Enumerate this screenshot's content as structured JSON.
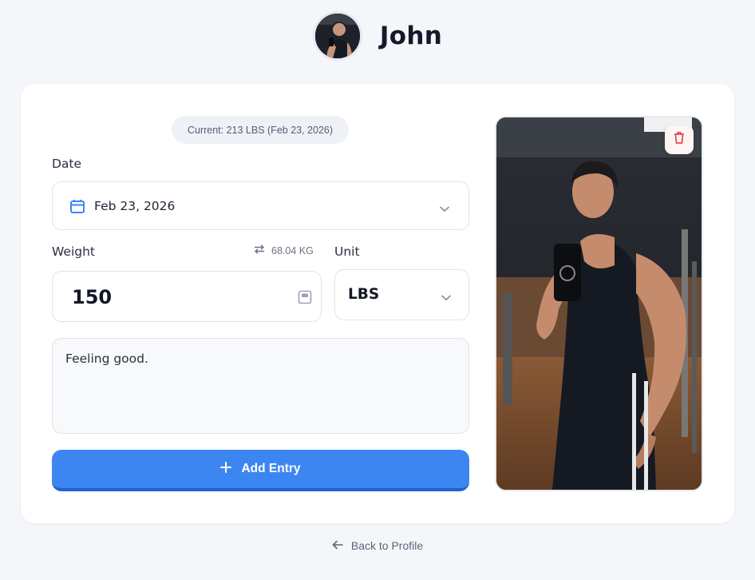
{
  "user": {
    "name": "John"
  },
  "current": {
    "text": "Current: 213 LBS (Feb 23, 2026)"
  },
  "form": {
    "date_label": "Date",
    "date_value": "Feb 23, 2026",
    "weight_label": "Weight",
    "conversion": "68.04 KG",
    "weight_value": "150",
    "unit_label": "Unit",
    "unit_value": "LBS",
    "notes": "Feeling good.",
    "add_button": "Add Entry"
  },
  "nav": {
    "back": "Back to Profile"
  },
  "colors": {
    "accent": "#3d86f2",
    "danger": "#e5484d",
    "background": "#f5f6f9"
  },
  "icons": [
    "calendar-icon",
    "chevron-down-icon",
    "swap-icon",
    "scale-icon",
    "plus-icon",
    "trash-icon",
    "arrow-left-icon"
  ]
}
